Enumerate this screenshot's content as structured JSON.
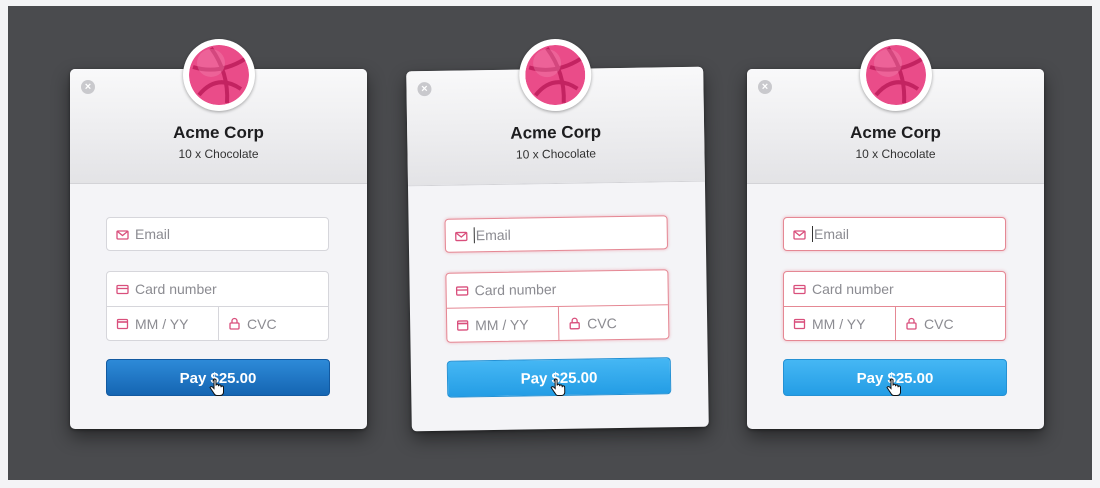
{
  "merchant": {
    "name": "Acme Corp",
    "product": "10 x Chocolate"
  },
  "form": {
    "email_placeholder": "Email",
    "card_number_placeholder": "Card number",
    "expiry_placeholder": "MM / YY",
    "cvc_placeholder": "CVC"
  },
  "pay_button": {
    "label": "Pay $25.00"
  },
  "icons": {
    "close": "close-icon",
    "logo": "dribbble-logo",
    "email": "envelope-icon",
    "card": "credit-card-icon",
    "expiry": "calendar-icon",
    "cvc": "lock-icon",
    "cursor": "hand-cursor-icon"
  },
  "colors": {
    "background": "#4a4b4e",
    "brand_pink": "#e94f88",
    "pay_dark": "#1a70bf",
    "pay_light": "#34abef",
    "focus_border": "#e58894"
  },
  "panels": [
    {
      "state": "default",
      "pay_style": "dark"
    },
    {
      "state": "email-focused",
      "pay_style": "light"
    },
    {
      "state": "email-focused",
      "pay_style": "light"
    }
  ]
}
